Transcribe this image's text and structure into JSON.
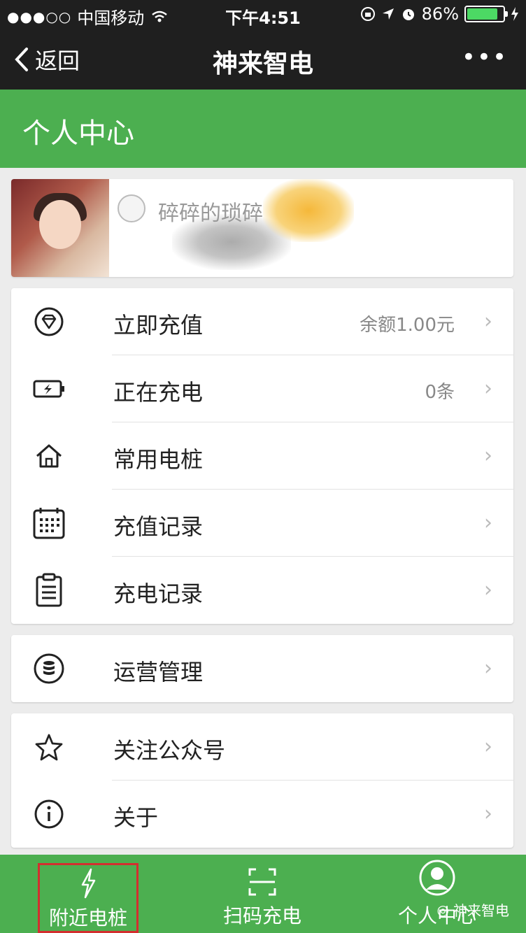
{
  "status_bar": {
    "signal": "●●●○○",
    "carrier": "中国移动",
    "time": "下午4:51",
    "battery": "86%",
    "battery_level": 0.86
  },
  "nav": {
    "back_label": "返回",
    "title": "神来智电",
    "more_label": "•••"
  },
  "header": {
    "title": "个人中心"
  },
  "profile": {
    "nickname": "碎碎的琐碎"
  },
  "menu_main": [
    {
      "label": "立即充值",
      "value": "余额1.00元",
      "icon": "diamond-icon"
    },
    {
      "label": "正在充电",
      "value": "0条",
      "icon": "battery-charging-icon"
    },
    {
      "label": "常用电桩",
      "value": "",
      "icon": "home-icon"
    },
    {
      "label": "充值记录",
      "value": "",
      "icon": "calendar-icon"
    },
    {
      "label": "充电记录",
      "value": "",
      "icon": "clipboard-icon"
    }
  ],
  "menu_ops": [
    {
      "label": "运营管理",
      "value": "",
      "icon": "database-icon"
    }
  ],
  "menu_misc": [
    {
      "label": "关注公众号",
      "value": "",
      "icon": "star-icon"
    },
    {
      "label": "关于",
      "value": "",
      "icon": "info-icon"
    }
  ],
  "tabs": [
    {
      "label": "附近电桩",
      "icon": "lightning-icon"
    },
    {
      "label": "扫码充电",
      "icon": "scan-icon"
    },
    {
      "label": "个人中心",
      "icon": "user-icon"
    }
  ],
  "watermark": "神来智电",
  "colors": {
    "green": "#4caf50",
    "dark": "#1f1f1f",
    "highlight_border": "#d32f2f"
  }
}
